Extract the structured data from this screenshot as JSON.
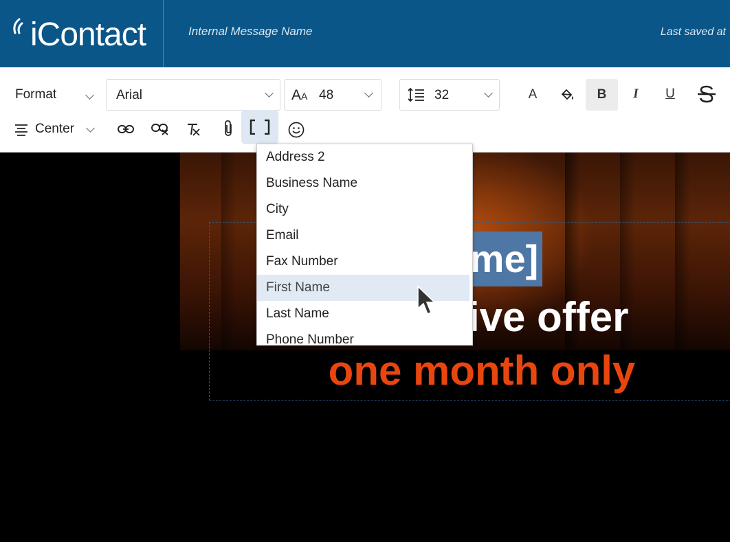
{
  "header": {
    "logo_text": "iContact",
    "message_name": "Internal Message Name",
    "last_saved": "Last saved at"
  },
  "toolbar": {
    "format_label": "Format",
    "font_family": "Arial",
    "font_size": "48",
    "line_height": "32",
    "align_label": "Center",
    "text_color_icon": "A"
  },
  "merge_fields": {
    "items": [
      {
        "label": "Address 2"
      },
      {
        "label": "Business Name"
      },
      {
        "label": "City"
      },
      {
        "label": "Email"
      },
      {
        "label": "Fax Number"
      },
      {
        "label": "First Name"
      },
      {
        "label": "Last Name"
      },
      {
        "label": "Phone Number"
      }
    ],
    "hovered": "First Name"
  },
  "content": {
    "fname_tag": "[fname]",
    "headline": "Exclusive offer",
    "subheadline": "one month only"
  },
  "colors": {
    "header_bg": "#0b5689",
    "selection_bg": "#4f77a5",
    "accent_orange": "#e9460f"
  }
}
